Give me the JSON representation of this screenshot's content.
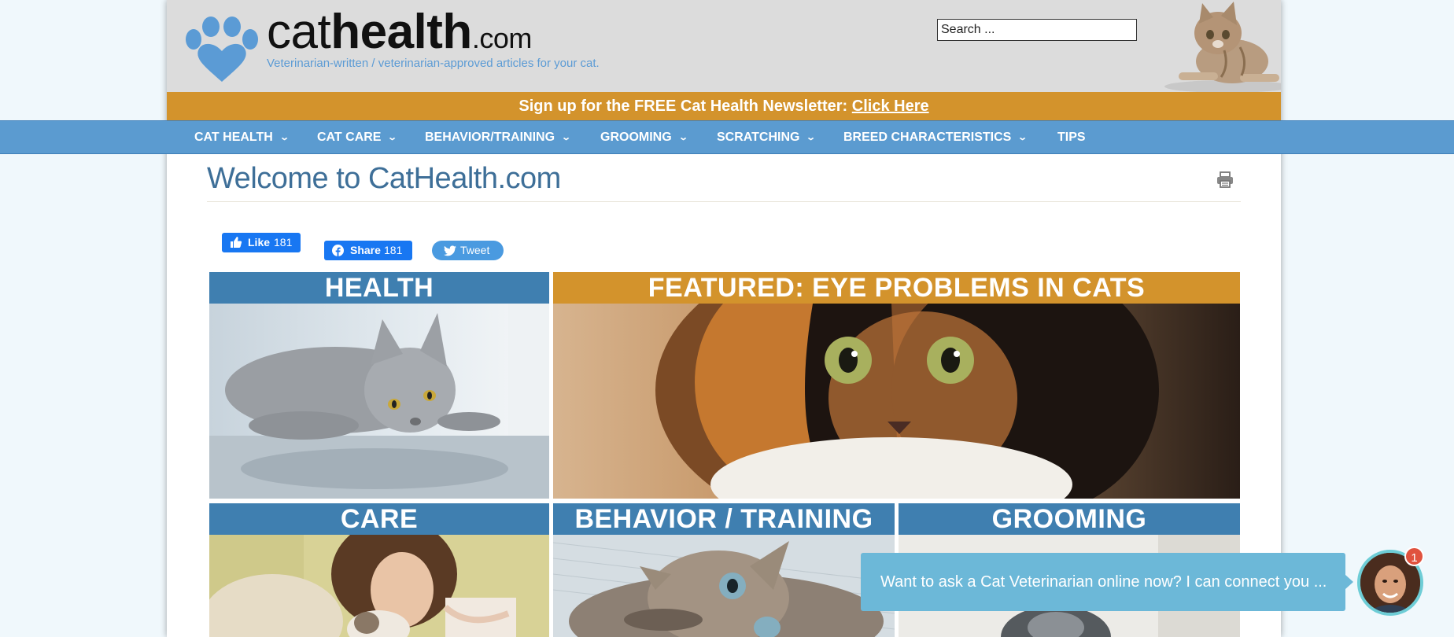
{
  "header": {
    "brand_part1": "cat",
    "brand_part2": "health",
    "brand_part3": ".com",
    "tagline": "Veterinarian-written / veterinarian-approved articles for your cat.",
    "search_placeholder": "Search ..."
  },
  "newsletter": {
    "text": "Sign up for the FREE Cat Health Newsletter:",
    "link": "Click Here"
  },
  "nav": {
    "items": [
      {
        "label": "CAT HEALTH"
      },
      {
        "label": "CAT CARE"
      },
      {
        "label": "BEHAVIOR/TRAINING"
      },
      {
        "label": "GROOMING"
      },
      {
        "label": "SCRATCHING"
      },
      {
        "label": "BREED CHARACTERISTICS"
      },
      {
        "label": "TIPS"
      }
    ]
  },
  "main": {
    "title": "Welcome to CatHealth.com"
  },
  "social": {
    "like_label": "Like",
    "like_count": "181",
    "share_label": "Share",
    "share_count": "181",
    "tweet_label": "Tweet"
  },
  "tiles": {
    "health": "HEALTH",
    "featured": "FEATURED: EYE PROBLEMS IN CATS",
    "care": "CARE",
    "behavior": "BEHAVIOR / TRAINING",
    "grooming": "GROOMING"
  },
  "chat": {
    "message": "Want to ask a Cat Veterinarian online now? I can connect you ...",
    "badge_count": "1"
  },
  "colors": {
    "nav_blue": "#5b9bd0",
    "tile_blue": "#3f7fb0",
    "gold": "#d3932c",
    "title_blue": "#3e6f98",
    "chat_blue": "#6cb8d8"
  },
  "icons": [
    "paw-logo-icon",
    "search-icon",
    "print-icon",
    "thumbs-up-icon",
    "facebook-icon",
    "twitter-icon",
    "chevron-down-icon"
  ]
}
